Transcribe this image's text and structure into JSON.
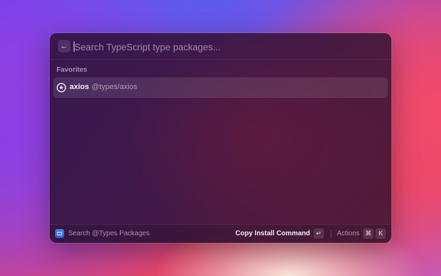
{
  "header": {
    "back_icon": "←",
    "search_placeholder": "Search TypeScript type packages..."
  },
  "sections": [
    {
      "title": "Favorites",
      "items": [
        {
          "icon": "star-circle-icon",
          "title": "axios",
          "subtitle": "@types/axios"
        }
      ]
    }
  ],
  "footer": {
    "extension_icon": "types-package-icon",
    "title": "Search @Types Packages",
    "primary_action": "Copy Install Command",
    "primary_shortcut": "↵",
    "actions_label": "Actions",
    "actions_shortcut": [
      "⌘",
      "K"
    ]
  },
  "colors": {
    "accent_icon": "#3b6fe6",
    "window_bg": "#3a1848"
  }
}
